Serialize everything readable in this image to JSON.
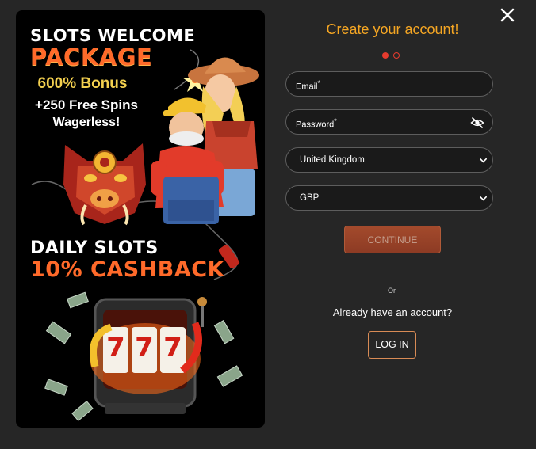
{
  "banner": {
    "line1": "SLOTS WELCOME",
    "line2": "PACKAGE",
    "bonus": "600% Bonus",
    "spins": "+250 Free Spins",
    "wager": "Wagerless!",
    "daily": "DAILY SLOTS",
    "cashback": "10% CASHBACK",
    "reel_symbols": [
      "7",
      "7",
      "7"
    ]
  },
  "form": {
    "title": "Create your account!",
    "steps": {
      "current": 1,
      "total": 2
    },
    "email_label": "Email",
    "password_label": "Password",
    "required_mark": "*",
    "country_value": "United Kingdom",
    "currency_value": "GBP",
    "continue_label": "CONTINUE",
    "or_label": "Or",
    "have_account_text": "Already have an account?",
    "login_label": "LOG IN"
  },
  "colors": {
    "accent": "#f5a623",
    "step_active": "#e63b2e",
    "continue_bg": "#9a4429",
    "login_border": "#d88b55"
  },
  "icons": {
    "close": "close-icon",
    "password_toggle": "eye-off-icon",
    "dropdown": "chevron-down-icon"
  }
}
